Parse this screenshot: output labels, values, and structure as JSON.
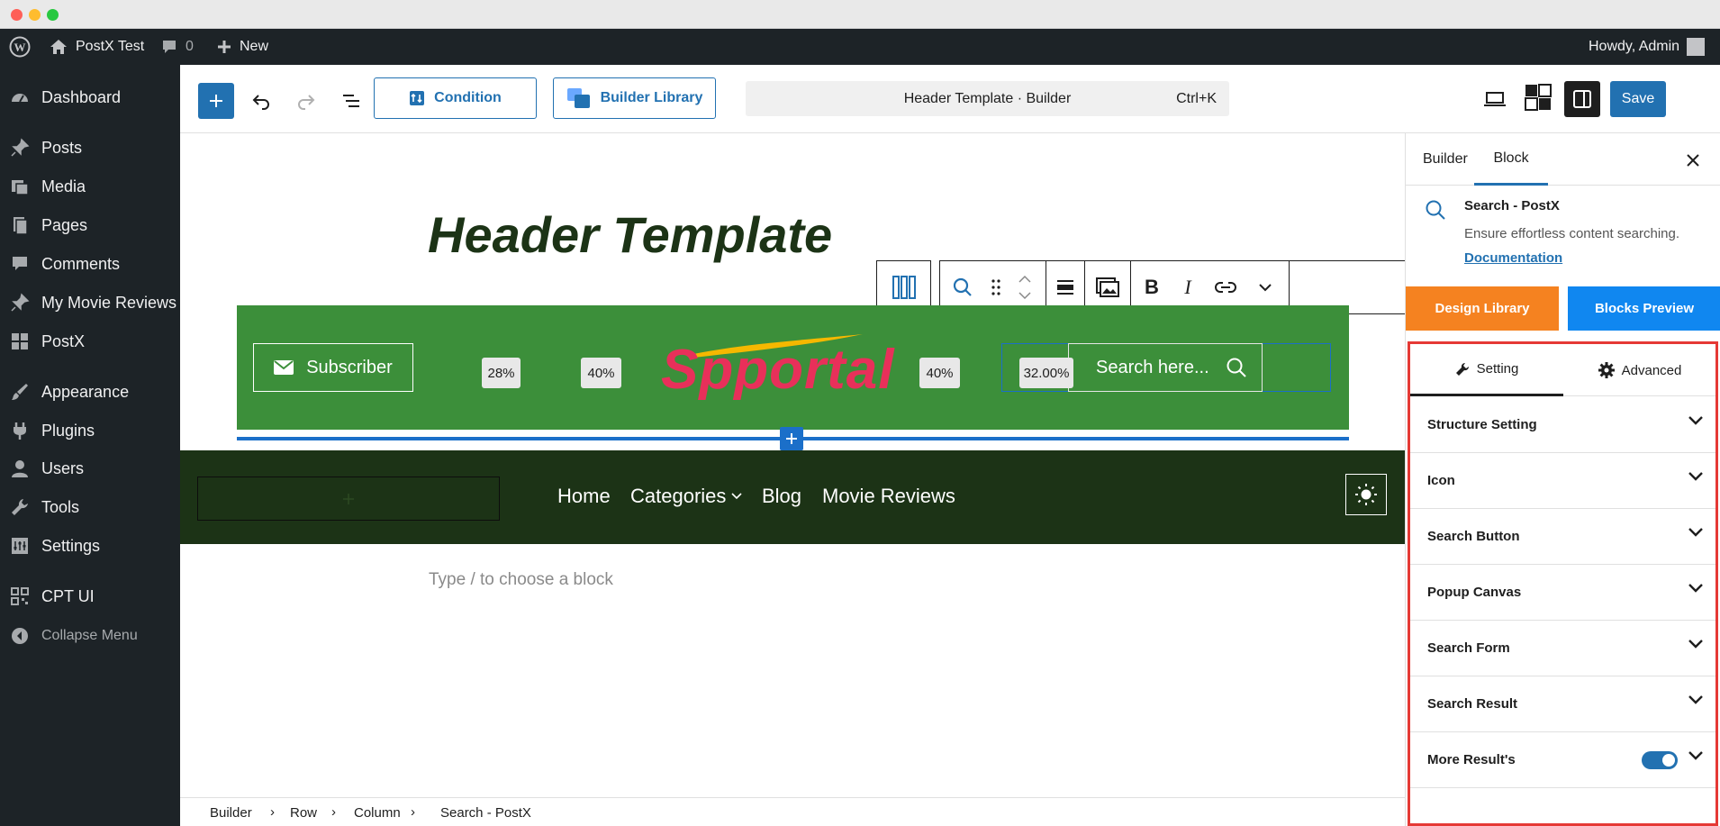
{
  "admin_bar": {
    "site_name": "PostX Test",
    "comments_count": "0",
    "new_label": "New",
    "howdy": "Howdy, Admin"
  },
  "sidebar": {
    "items": [
      {
        "label": "Dashboard",
        "icon": "dashboard-icon"
      },
      {
        "label": "Posts",
        "icon": "pin-icon"
      },
      {
        "label": "Media",
        "icon": "media-icon"
      },
      {
        "label": "Pages",
        "icon": "pages-icon"
      },
      {
        "label": "Comments",
        "icon": "comment-icon"
      },
      {
        "label": "My Movie Reviews",
        "icon": "pin-icon"
      },
      {
        "label": "PostX",
        "icon": "postx-icon"
      },
      {
        "label": "Appearance",
        "icon": "brush-icon"
      },
      {
        "label": "Plugins",
        "icon": "plug-icon"
      },
      {
        "label": "Users",
        "icon": "user-icon"
      },
      {
        "label": "Tools",
        "icon": "wrench-icon"
      },
      {
        "label": "Settings",
        "icon": "settings-icon"
      },
      {
        "label": "CPT UI",
        "icon": "grid-icon"
      },
      {
        "label": "Collapse Menu",
        "icon": "collapse-icon"
      }
    ]
  },
  "toolbar": {
    "condition_label": "Condition",
    "builder_library_label": "Builder Library",
    "command_title": "Header Template · Builder",
    "shortcut": "Ctrl+K",
    "save_label": "Save"
  },
  "canvas": {
    "heading": "Header Template",
    "subscriber_label": "Subscriber",
    "logo_text": "Spportal",
    "percent_badges": [
      "28%",
      "40%",
      "40%",
      "32.00%"
    ],
    "search_placeholder": "Search here...",
    "nav_items": [
      "Home",
      "Categories",
      "Blog",
      "Movie Reviews"
    ],
    "block_placeholder": "Type / to choose a block"
  },
  "panel": {
    "tabs": [
      "Builder",
      "Block"
    ],
    "active_tab": "Block",
    "block_title": "Search - PostX",
    "block_desc": "Ensure effortless content searching.",
    "doc_link": "Documentation",
    "design_library": "Design Library",
    "blocks_preview": "Blocks Preview",
    "setting_tab": "Setting",
    "advanced_tab": "Advanced",
    "sections": [
      "Structure Setting",
      "Icon",
      "Search Button",
      "Popup Canvas",
      "Search Form",
      "Search Result",
      "More Result's"
    ],
    "more_results_enabled": true
  },
  "breadcrumb": [
    "Builder",
    "Row",
    "Column",
    "Search - PostX"
  ],
  "colors": {
    "admin_dark": "#1d2327",
    "wp_blue": "#2271b1",
    "header_green": "#3c8f3a",
    "nav_dark_green": "#1c3316",
    "logo_red": "#e8305a",
    "design_orange": "#f58220",
    "preview_blue": "#1087f0",
    "highlight_red": "#e53935"
  }
}
